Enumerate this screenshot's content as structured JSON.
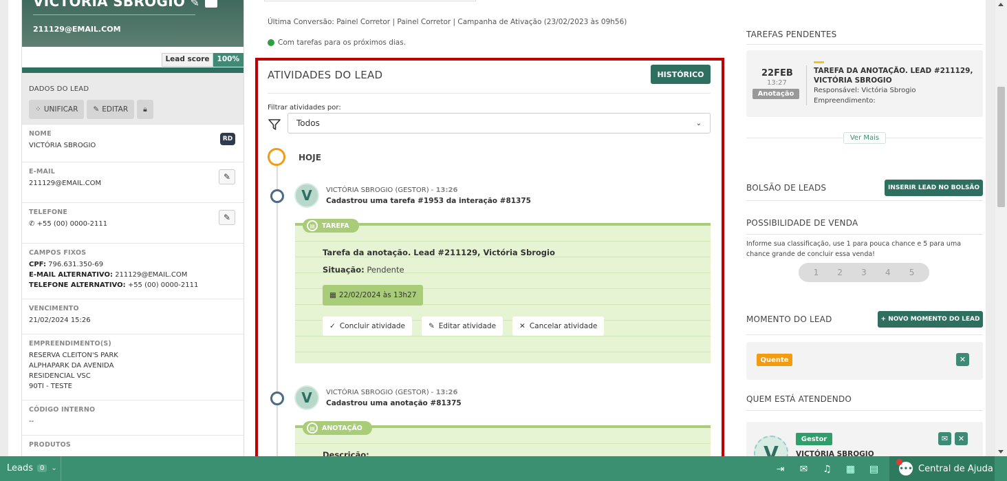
{
  "lead": {
    "name": "VICTÓRIA SBROGIO",
    "email": "211129@EMAIL.COM",
    "score_label": "Lead score",
    "score_value": "100%"
  },
  "dados": {
    "title": "DADOS DO LEAD",
    "unificar": "UNIFICAR",
    "editar": "EDITAR",
    "rd_badge": "RD"
  },
  "fields": {
    "nome_k": "NOME",
    "nome_v": "VICTÓRIA SBROGIO",
    "email_k": "E-MAIL",
    "email_v": "211129@EMAIL.COM",
    "tel_k": "TELEFONE",
    "tel_v": "+55 (00) 0000-2111",
    "fixos_k": "CAMPOS FIXOS",
    "cpf_k": "CPF:",
    "cpf_v": "796.631.350-69",
    "ealt_k": "E-MAIL ALTERNATIVO:",
    "ealt_v": "211129@EMAIL.COM",
    "talt_k": "TELEFONE ALTERNATIVO:",
    "talt_v": "+55 (00) 0000-2111",
    "venc_k": "VENCIMENTO",
    "venc_v": "21/02/2024 15:26",
    "emp_k": "EMPREENDIMENTO(S)",
    "emp_1": "RESERVA CLEITON'S PARK",
    "emp_2": "ALPHAPARK DA AVENIDA",
    "emp_3": "RESIDENCIAL VSC",
    "emp_4": "90TI - TESTE",
    "cod_k": "CÓDIGO INTERNO",
    "cod_v": "--",
    "prod_k": "PRODUTOS"
  },
  "middle": {
    "conversion": "Última Conversão: Painel Corretor | Painel Corretor | Campanha de Ativação (23/02/2023 às 09h56)",
    "status": "Com tarefas para os próximos dias."
  },
  "activities": {
    "title": "ATIVIDADES DO LEAD",
    "history_btn": "HISTÓRICO",
    "filter_label": "Filtrar atividades por:",
    "filter_value": "Todos",
    "today": "HOJE",
    "items": [
      {
        "avatar": "V",
        "author": "VICTÓRIA SBROGIO (GESTOR) -",
        "time": "13:26",
        "action": "Cadastrou uma tarefa #1953 da interação #81375",
        "tag": "TAREFA",
        "card_title": "Tarefa da anotação. Lead #211129, Victória Sbrogio",
        "situacao_k": "Situação:",
        "situacao_v": "Pendente",
        "date": "22/02/2024 às 13h27",
        "btn_concluir": "Concluir atividade",
        "btn_editar": "Editar atividade",
        "btn_cancelar": "Cancelar atividade"
      },
      {
        "avatar": "V",
        "author": "VICTÓRIA SBROGIO (GESTOR) -",
        "time": "13:26",
        "action": "Cadastrou uma anotação #81375",
        "tag": "ANOTAÇÃO",
        "card_title": "Descrição:"
      }
    ]
  },
  "right": {
    "pending_title": "TAREFAS PENDENTES",
    "task": {
      "day": "22FEB",
      "time": "13:27",
      "type": "Anotação",
      "title": "TAREFA DA ANOTAÇÃO. LEAD #211129, VICTÓRIA SBROGIO",
      "resp": "Responsável: Victória Sbrogio",
      "emp": "Empreendimento:"
    },
    "ver_mais": "Ver Mais",
    "bolsao_title": "BOLSÃO DE LEADS",
    "bolsao_btn": "INSERIR LEAD NO BOLSÃO",
    "poss_title": "POSSIBILIDADE DE VENDA",
    "poss_text": "Informe sua classificação, use 1 para pouca chance e 5 para uma chance grande de concluir essa venda!",
    "rating": [
      "1",
      "2",
      "3",
      "4",
      "5"
    ],
    "momento_title": "MOMENTO DO LEAD",
    "momento_btn": "+ NOVO MOMENTO DO LEAD",
    "momento_tag": "Quente",
    "atend_title": "QUEM ESTÁ ATENDENDO",
    "atend_role": "Gestor",
    "atend_name": "VICTÓRIA SBROGIO",
    "atend_avatar": "V"
  },
  "bottom": {
    "leads_label": "Leads",
    "leads_count": "0",
    "help": "Central de Ajuda"
  },
  "colors": {
    "brand": "#2f6f5f",
    "accent_green": "#3a9070",
    "highlight": "#c00000",
    "card_bg": "#e6f4d4",
    "warning": "#f39c12"
  },
  "icons": [
    "pencil-icon",
    "camera-icon",
    "unify-icon",
    "lock-icon",
    "phone-icon",
    "filter-icon",
    "chevron-down-icon",
    "document-icon",
    "calendar-icon",
    "check-icon",
    "close-icon",
    "mail-icon",
    "arrow-right-bar-icon",
    "inbox-star-icon",
    "bell-icon",
    "calendar-icon",
    "calculator-icon",
    "chat-icon"
  ]
}
